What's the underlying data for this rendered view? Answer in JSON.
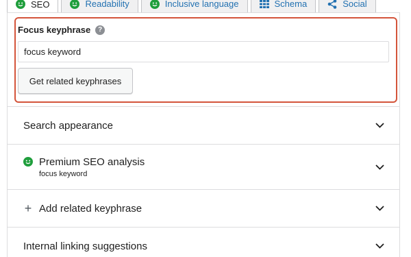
{
  "tabs": [
    {
      "label": "SEO",
      "active": true
    },
    {
      "label": "Readability"
    },
    {
      "label": "Inclusive language"
    },
    {
      "label": "Schema"
    },
    {
      "label": "Social"
    }
  ],
  "focus": {
    "label": "Focus keyphrase",
    "input_value": "focus keyword",
    "button_label": "Get related keyphrases"
  },
  "sections": [
    {
      "title": "Search appearance"
    },
    {
      "title": "Premium SEO analysis",
      "subtitle": "focus keyword",
      "icon": "smile-icon"
    },
    {
      "title": "Add related keyphrase",
      "icon": "plus-icon"
    },
    {
      "title": "Internal linking suggestions"
    }
  ],
  "colors": {
    "accent": "#2271b1",
    "highlight": "#d4543a",
    "good": "#1f9e3c"
  }
}
